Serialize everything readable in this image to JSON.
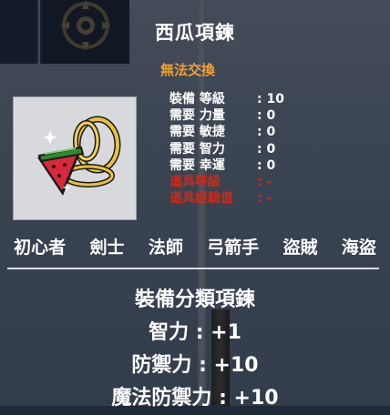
{
  "item": {
    "name": "西瓜項鍊",
    "tradeability": "無法交換",
    "icon": "watermelon-necklace-icon"
  },
  "requirements": [
    {
      "label": "裝備 等級",
      "value": ": 10"
    },
    {
      "label": "需要 力量",
      "value": ": 0"
    },
    {
      "label": "需要 敏捷",
      "value": ": 0"
    },
    {
      "label": "需要 智力",
      "value": ": 0"
    },
    {
      "label": "需要 幸運",
      "value": ": 0"
    }
  ],
  "item_info": [
    {
      "label": "道具等級",
      "value": ": -"
    },
    {
      "label": "道具經驗值",
      "value": ": -"
    }
  ],
  "jobs": [
    "初心者",
    "劍士",
    "法師",
    "弓箭手",
    "盜賊",
    "海盜"
  ],
  "details": {
    "category": "裝備分類項鍊",
    "int_bonus": "智力 : +1",
    "def_bonus": "防禦力 : +10",
    "mdef_bonus": "魔法防禦力 : +10"
  },
  "colors": {
    "title": "#ffffff",
    "untradeable": "#f0a030",
    "item_info": "#cc2a1a"
  }
}
